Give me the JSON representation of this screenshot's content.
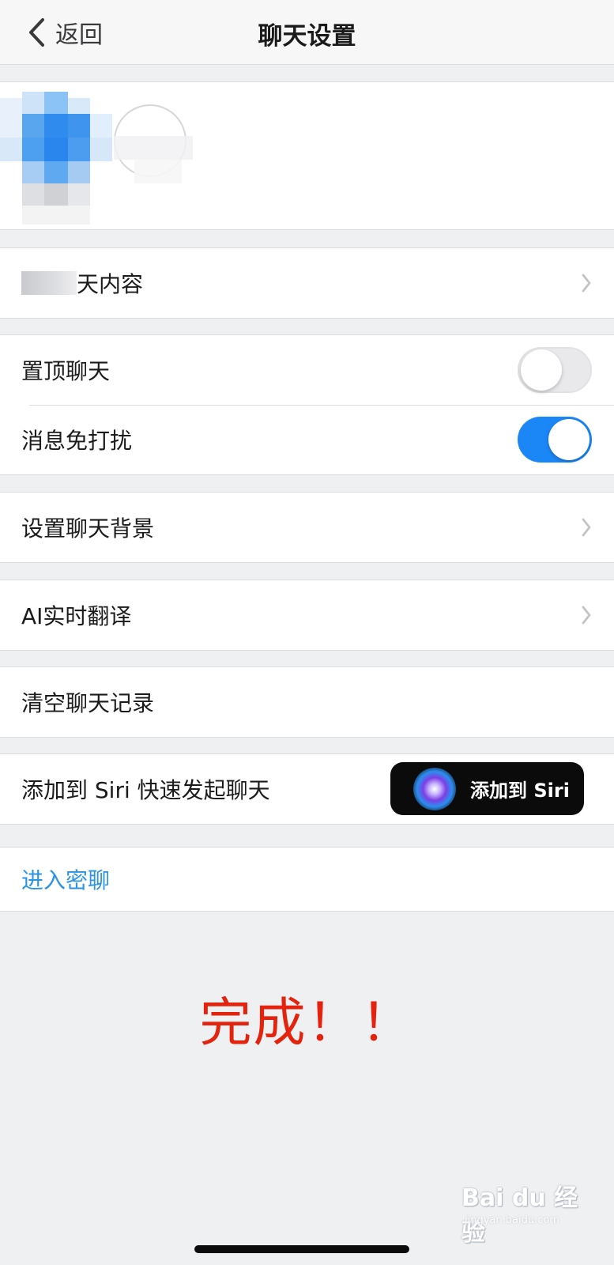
{
  "nav": {
    "back_label": "返回",
    "title": "聊天设置"
  },
  "profile": {
    "avatar": "pixelated-avatar",
    "add_member_icon": "add-circle-icon"
  },
  "search_history": {
    "label_visible": "天内容",
    "icon": "chevron-right-icon"
  },
  "pin_chat": {
    "label": "置顶聊天",
    "enabled": false
  },
  "mute": {
    "label": "消息免打扰",
    "enabled": true
  },
  "chat_background": {
    "label": "设置聊天背景",
    "icon": "chevron-right-icon"
  },
  "ai_translate": {
    "label": "AI实时翻译",
    "icon": "chevron-right-icon"
  },
  "clear_history": {
    "label": "清空聊天记录"
  },
  "siri": {
    "label": "添加到 Siri 快速发起聊天",
    "button_label": "添加到 Siri",
    "icon": "siri-orb-icon"
  },
  "secret_chat": {
    "label": "进入密聊"
  },
  "annotation": {
    "text": "完成！！"
  },
  "watermark": {
    "main": "Bai du 经验",
    "sub": "jingyan.baidu.com"
  },
  "colors": {
    "accent_blue": "#1b86f5",
    "link_blue": "#2a93e6",
    "annotation_red": "#e4230f",
    "background": "#eff0f2"
  }
}
